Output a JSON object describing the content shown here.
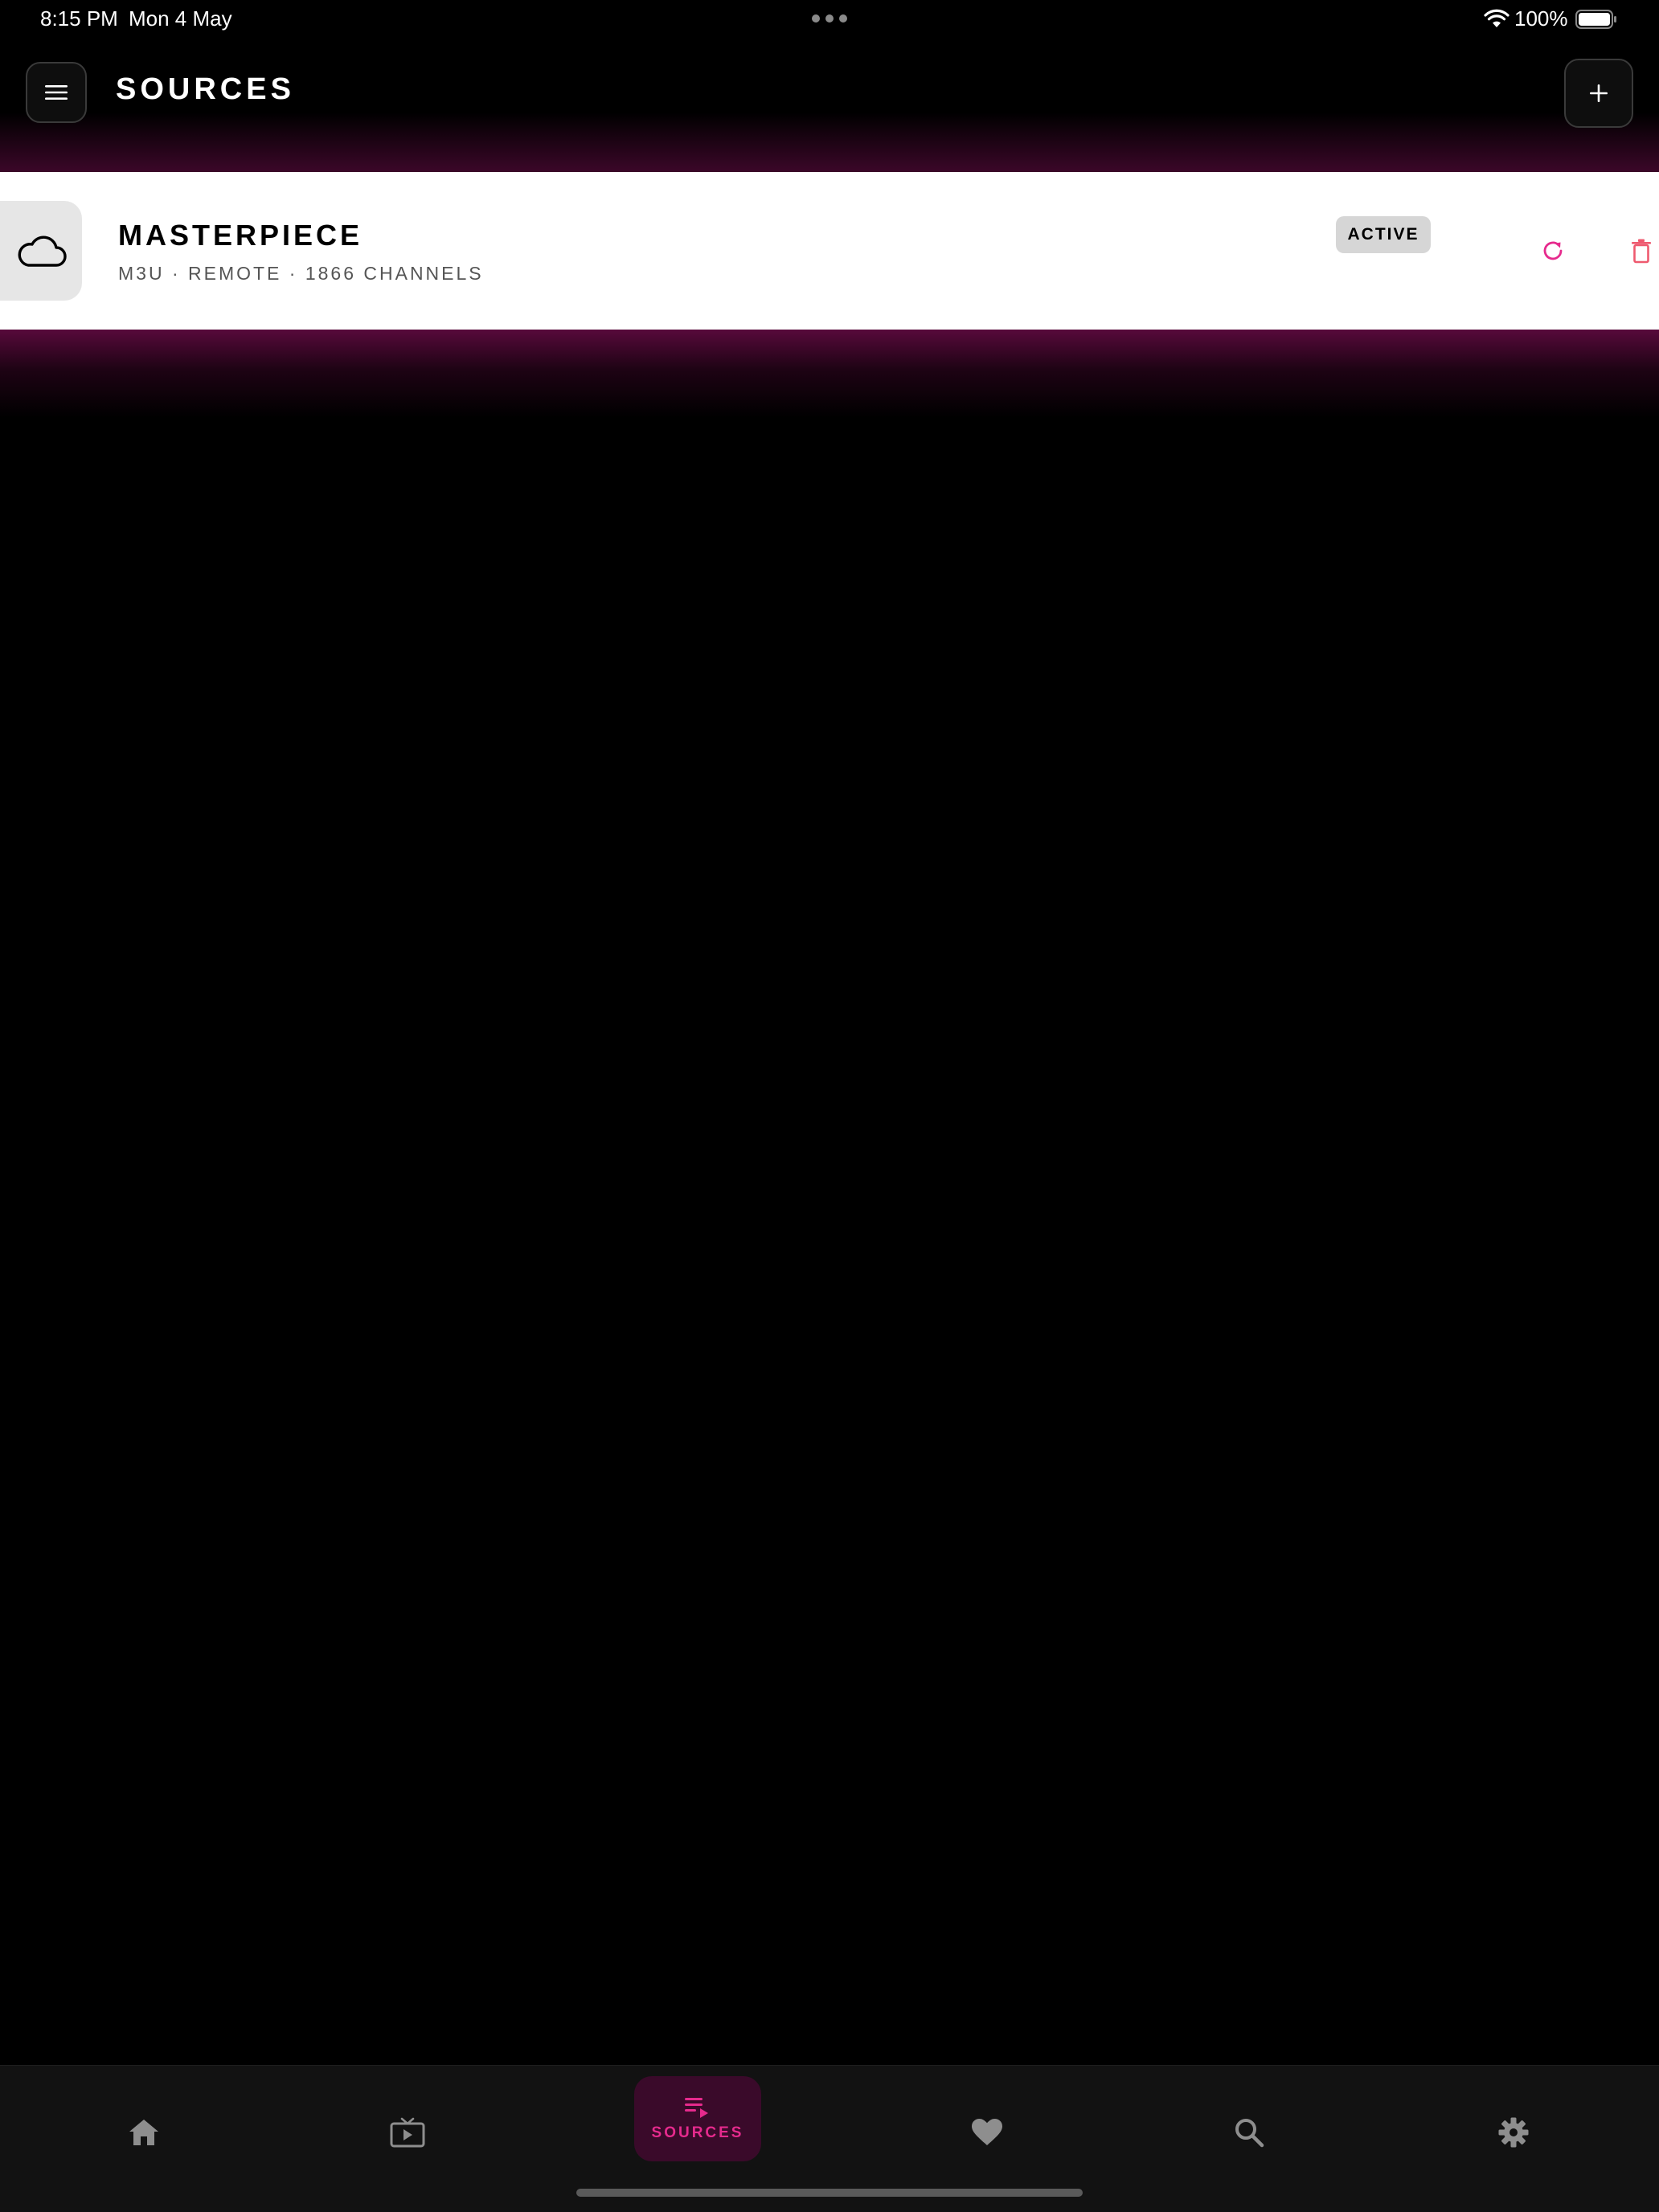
{
  "status_bar": {
    "time": "8:15 PM",
    "date": "Mon 4 May",
    "battery_percent": "100%",
    "icons": [
      "wifi-icon",
      "battery-icon",
      "multitasking-dots-icon"
    ]
  },
  "header": {
    "title": "SOURCES",
    "menu_icon": "hamburger-icon",
    "add_icon": "plus-icon"
  },
  "sources": [
    {
      "name": "MASTERPIECE",
      "meta": "M3U · REMOTE · 1866 CHANNELS",
      "status": "ACTIVE",
      "icon": "cloud-icon",
      "actions": [
        "refresh-icon",
        "trash-icon"
      ]
    }
  ],
  "bottom_nav": {
    "items": [
      {
        "icon": "home-icon",
        "label": ""
      },
      {
        "icon": "live-tv-icon",
        "label": ""
      },
      {
        "icon": "playlist-icon",
        "label": "SOURCES",
        "active": true
      },
      {
        "icon": "heart-icon",
        "label": ""
      },
      {
        "icon": "search-icon",
        "label": ""
      },
      {
        "icon": "gear-icon",
        "label": ""
      }
    ]
  },
  "colors": {
    "accent": "#e62a8d",
    "background": "#000000",
    "card": "#ffffff",
    "nav_background": "#121212",
    "active_tab_background": "#3a0a2a",
    "badge_background": "#d6d6d6",
    "delete_red": "#ee5a6f"
  }
}
